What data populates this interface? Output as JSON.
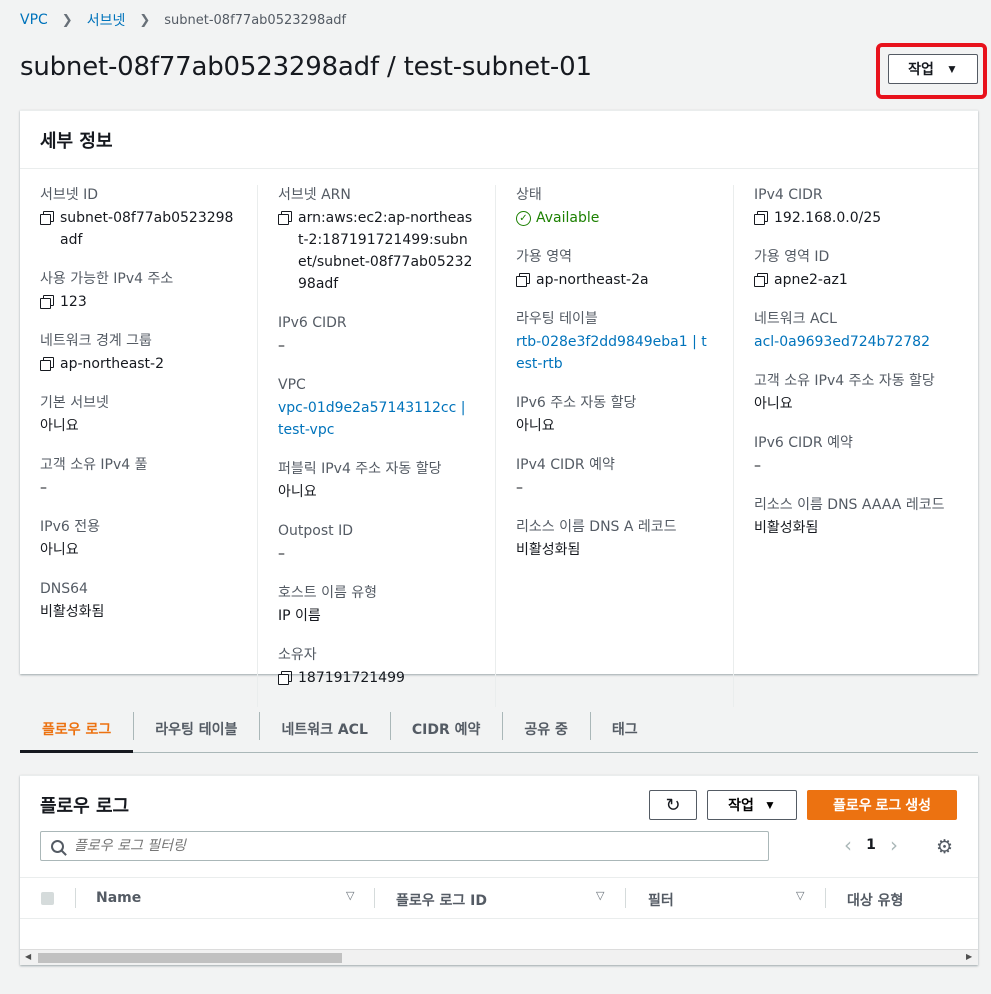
{
  "breadcrumb": {
    "items": [
      "VPC",
      "서브넷"
    ],
    "current": "subnet-08f77ab0523298adf"
  },
  "page": {
    "title": "subnet-08f77ab0523298adf / test-subnet-01",
    "action_label": "작업"
  },
  "details": {
    "title": "세부 정보",
    "columns": [
      [
        {
          "label": "서브넷 ID",
          "value": "subnet-08f77ab0523298adf",
          "copy": true
        },
        {
          "label": "사용 가능한 IPv4 주소",
          "value": "123",
          "copy": true
        },
        {
          "label": "네트워크 경계 그룹",
          "value": "ap-northeast-2",
          "copy": true
        },
        {
          "label": "기본 서브넷",
          "value": "아니요"
        },
        {
          "label": "고객 소유 IPv4 풀",
          "value": "–"
        },
        {
          "label": "IPv6 전용",
          "value": "아니요"
        },
        {
          "label": "DNS64",
          "value": "비활성화됨"
        }
      ],
      [
        {
          "label": "서브넷 ARN",
          "value": "arn:aws:ec2:ap-northeast-2:187191721499:subnet/subnet-08f77ab0523298adf",
          "copy": true
        },
        {
          "label": "IPv6 CIDR",
          "value": "–"
        },
        {
          "label": "VPC",
          "value": "vpc-01d9e2a57143112cc | test-vpc",
          "link": true
        },
        {
          "label": "퍼블릭 IPv4 주소 자동 할당",
          "value": "아니요"
        },
        {
          "label": "Outpost ID",
          "value": "–"
        },
        {
          "label": "호스트 이름 유형",
          "value": "IP 이름"
        },
        {
          "label": "소유자",
          "value": "187191721499",
          "copy": true
        }
      ],
      [
        {
          "label": "상태",
          "value": "Available",
          "status": true
        },
        {
          "label": "가용 영역",
          "value": "ap-northeast-2a",
          "copy": true
        },
        {
          "label": "라우팅 테이블",
          "value": "rtb-028e3f2dd9849eba1 | test-rtb",
          "link": true
        },
        {
          "label": "IPv6 주소 자동 할당",
          "value": "아니요"
        },
        {
          "label": "IPv4 CIDR 예약",
          "value": "–"
        },
        {
          "label": "리소스 이름 DNS A 레코드",
          "value": "비활성화됨"
        }
      ],
      [
        {
          "label": "IPv4 CIDR",
          "value": "192.168.0.0/25",
          "copy": true
        },
        {
          "label": "가용 영역 ID",
          "value": "apne2-az1",
          "copy": true
        },
        {
          "label": "네트워크 ACL",
          "value": "acl-0a9693ed724b72782",
          "link": true
        },
        {
          "label": "고객 소유 IPv4 주소 자동 할당",
          "value": "아니요"
        },
        {
          "label": "IPv6 CIDR 예약",
          "value": "–"
        },
        {
          "label": "리소스 이름 DNS AAAA 레코드",
          "value": "비활성화됨"
        }
      ]
    ]
  },
  "tabs": [
    "플로우 로그",
    "라우팅 테이블",
    "네트워크 ACL",
    "CIDR 예약",
    "공유 중",
    "태그"
  ],
  "flow_logs": {
    "title": "플로우 로그",
    "action_label": "작업",
    "create_label": "플로우 로그 생성",
    "filter_placeholder": "플로우 로그 필터링",
    "page": "1",
    "columns": [
      "Name",
      "플로우 로그 ID",
      "필터",
      "대상 유형"
    ]
  },
  "colors": {
    "link": "#0073bb",
    "accent": "#ec7211",
    "success": "#1d8102",
    "highlight": "#e8121c"
  }
}
